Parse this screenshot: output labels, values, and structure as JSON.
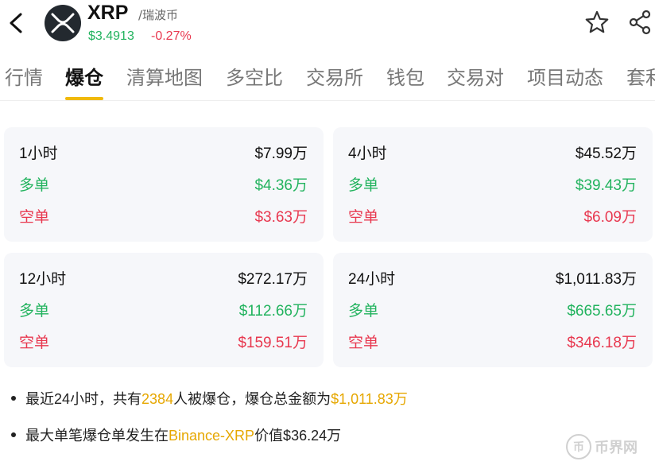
{
  "header": {
    "symbol": "XRP",
    "name": "/瑞波币",
    "price": "$3.4913",
    "change": "-0.27%"
  },
  "tabs": [
    "行情",
    "爆仓",
    "清算地图",
    "多空比",
    "交易所",
    "钱包",
    "交易对",
    "项目动态",
    "套利"
  ],
  "active_tab": "爆仓",
  "cards": [
    {
      "period": "1小时",
      "total": "$7.99万",
      "long_label": "多单",
      "long": "$4.36万",
      "short_label": "空单",
      "short": "$3.63万"
    },
    {
      "period": "4小时",
      "total": "$45.52万",
      "long_label": "多单",
      "long": "$39.43万",
      "short_label": "空单",
      "short": "$6.09万"
    },
    {
      "period": "12小时",
      "total": "$272.17万",
      "long_label": "多单",
      "long": "$112.66万",
      "short_label": "空单",
      "short": "$159.51万"
    },
    {
      "period": "24小时",
      "total": "$1,011.83万",
      "long_label": "多单",
      "long": "$665.65万",
      "short_label": "空单",
      "short": "$346.18万"
    }
  ],
  "summary": {
    "line1_a": "最近24小时，共有",
    "line1_count": "2384",
    "line1_b": "人被爆仓，爆仓总金额为",
    "line1_amount": "$1,011.83万",
    "line2_a": "最大单笔爆仓单发生在",
    "line2_exchange": "Binance-XRP",
    "line2_b": "价值$36.24万"
  },
  "watermark": {
    "icon": "币",
    "text": "币界网"
  },
  "colors": {
    "long": "#22b35e",
    "short": "#e8384f",
    "accent": "#f0b90b",
    "highlight": "#e6a700"
  }
}
